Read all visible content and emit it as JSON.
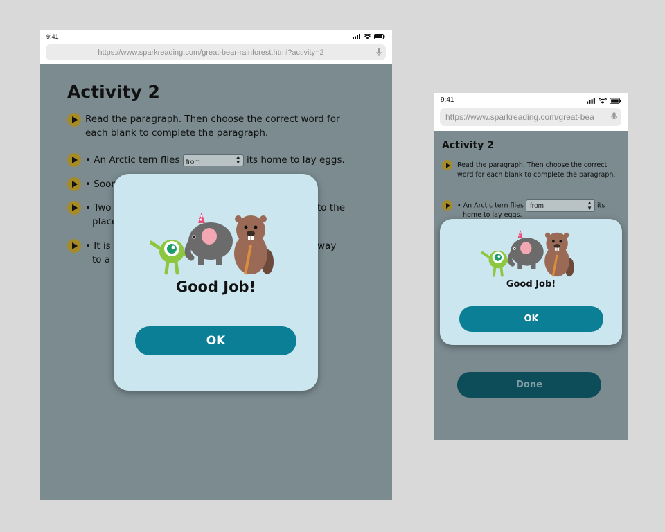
{
  "status_time": "9:41",
  "large_screen": {
    "url": "https://www.sparkreading.com/great-bear-rainforest.html?activity=2",
    "title": "Activity 2",
    "instructions": "Read the paragraph. Then choose the correct word for each blank to complete the paragraph.",
    "items": [
      {
        "before": "• An Arctic tern flies",
        "select": "from",
        "after": "its home to lay eggs."
      },
      {
        "before": "• Soon"
      },
      {
        "before": "• Two y",
        "right": "to the",
        "line2": "place"
      },
      {
        "before": "• It is",
        "right": "way",
        "line2": "to a p"
      }
    ],
    "dialog": {
      "message": "Good Job!",
      "ok_label": "OK"
    }
  },
  "small_screen": {
    "url": "https://www.sparkreading.com/great-bea",
    "title": "Activity 2",
    "instructions": "Read the paragraph. Then choose the correct word for each blank to complete the paragraph.",
    "items": [
      {
        "before": "• An Arctic tern flies",
        "select": "from",
        "after": "its",
        "line2": "home to lay eggs."
      }
    ],
    "dialog": {
      "message": "Good Job!",
      "ok_label": "OK"
    },
    "done_label": "Done"
  },
  "icons": {
    "audio": "play-audio-icon",
    "signal": "signal-bars-icon",
    "wifi": "wifi-icon",
    "battery": "battery-icon",
    "mic": "microphone-icon",
    "dropdown": "chevron-updown-icon"
  },
  "colors": {
    "backdrop": "#7b8b90",
    "dialog": "#cce6f0",
    "ok_button": "#0a7f95",
    "done_button": "#0d4d59",
    "audio_button": "#a58a28"
  }
}
